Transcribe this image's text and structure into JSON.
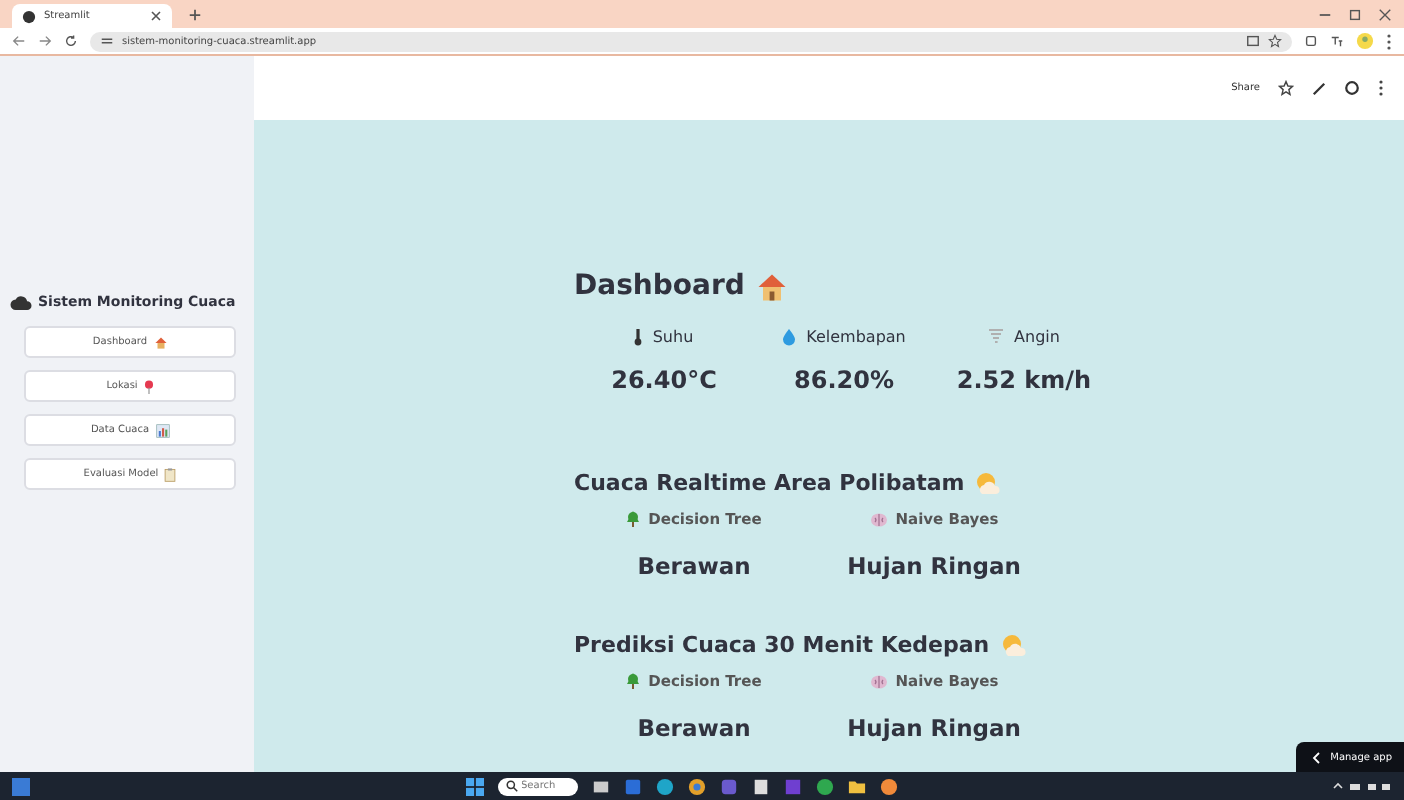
{
  "browser": {
    "tab_title": "Streamlit",
    "url": "sistem-monitoring-cuaca.streamlit.app"
  },
  "app_header": {
    "share": "Share"
  },
  "sidebar": {
    "title": "Sistem Monitoring Cuaca",
    "items": [
      {
        "label": "Dashboard"
      },
      {
        "label": "Lokasi"
      },
      {
        "label": "Data Cuaca"
      },
      {
        "label": "Evaluasi Model"
      }
    ]
  },
  "dashboard": {
    "title": "Dashboard",
    "metrics": [
      {
        "label": "Suhu",
        "value": "26.40°C"
      },
      {
        "label": "Kelembapan",
        "value": "86.20%"
      },
      {
        "label": "Angin",
        "value": "2.52 km/h"
      }
    ]
  },
  "sections": [
    {
      "title": "Cuaca Realtime Area Polibatam",
      "models": [
        {
          "label": "Decision Tree",
          "result": "Berawan"
        },
        {
          "label": "Naive Bayes",
          "result": "Hujan Ringan"
        }
      ]
    },
    {
      "title": "Prediksi Cuaca 30 Menit Kedepan",
      "models": [
        {
          "label": "Decision Tree",
          "result": "Berawan"
        },
        {
          "label": "Naive Bayes",
          "result": "Hujan Ringan"
        }
      ]
    }
  ],
  "manage_app": "Manage app",
  "taskbar": {
    "search_placeholder": "Search"
  }
}
